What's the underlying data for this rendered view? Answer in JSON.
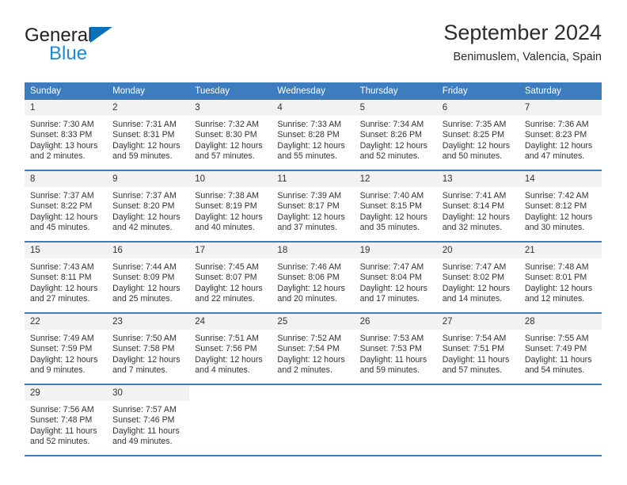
{
  "brand": {
    "name_line1": "General",
    "name_line2": "Blue",
    "flag_icon": "triangle-flag-icon",
    "color_dark": "#231f20",
    "color_blue": "#1a8bd6"
  },
  "header": {
    "title": "September 2024",
    "location": "Benimuslem, Valencia, Spain"
  },
  "theme": {
    "header_blue": "#3d7cbf",
    "daynum_background": "#f2f2f2",
    "text": "#333333"
  },
  "weekdays": [
    "Sunday",
    "Monday",
    "Tuesday",
    "Wednesday",
    "Thursday",
    "Friday",
    "Saturday"
  ],
  "labels": {
    "sunrise_prefix": "Sunrise:",
    "sunset_prefix": "Sunset:",
    "daylight_prefix": "Daylight:"
  },
  "weeks": [
    [
      {
        "day": "1",
        "sunrise": "Sunrise: 7:30 AM",
        "sunset": "Sunset: 8:33 PM",
        "daylight": "Daylight: 13 hours and 2 minutes."
      },
      {
        "day": "2",
        "sunrise": "Sunrise: 7:31 AM",
        "sunset": "Sunset: 8:31 PM",
        "daylight": "Daylight: 12 hours and 59 minutes."
      },
      {
        "day": "3",
        "sunrise": "Sunrise: 7:32 AM",
        "sunset": "Sunset: 8:30 PM",
        "daylight": "Daylight: 12 hours and 57 minutes."
      },
      {
        "day": "4",
        "sunrise": "Sunrise: 7:33 AM",
        "sunset": "Sunset: 8:28 PM",
        "daylight": "Daylight: 12 hours and 55 minutes."
      },
      {
        "day": "5",
        "sunrise": "Sunrise: 7:34 AM",
        "sunset": "Sunset: 8:26 PM",
        "daylight": "Daylight: 12 hours and 52 minutes."
      },
      {
        "day": "6",
        "sunrise": "Sunrise: 7:35 AM",
        "sunset": "Sunset: 8:25 PM",
        "daylight": "Daylight: 12 hours and 50 minutes."
      },
      {
        "day": "7",
        "sunrise": "Sunrise: 7:36 AM",
        "sunset": "Sunset: 8:23 PM",
        "daylight": "Daylight: 12 hours and 47 minutes."
      }
    ],
    [
      {
        "day": "8",
        "sunrise": "Sunrise: 7:37 AM",
        "sunset": "Sunset: 8:22 PM",
        "daylight": "Daylight: 12 hours and 45 minutes."
      },
      {
        "day": "9",
        "sunrise": "Sunrise: 7:37 AM",
        "sunset": "Sunset: 8:20 PM",
        "daylight": "Daylight: 12 hours and 42 minutes."
      },
      {
        "day": "10",
        "sunrise": "Sunrise: 7:38 AM",
        "sunset": "Sunset: 8:19 PM",
        "daylight": "Daylight: 12 hours and 40 minutes."
      },
      {
        "day": "11",
        "sunrise": "Sunrise: 7:39 AM",
        "sunset": "Sunset: 8:17 PM",
        "daylight": "Daylight: 12 hours and 37 minutes."
      },
      {
        "day": "12",
        "sunrise": "Sunrise: 7:40 AM",
        "sunset": "Sunset: 8:15 PM",
        "daylight": "Daylight: 12 hours and 35 minutes."
      },
      {
        "day": "13",
        "sunrise": "Sunrise: 7:41 AM",
        "sunset": "Sunset: 8:14 PM",
        "daylight": "Daylight: 12 hours and 32 minutes."
      },
      {
        "day": "14",
        "sunrise": "Sunrise: 7:42 AM",
        "sunset": "Sunset: 8:12 PM",
        "daylight": "Daylight: 12 hours and 30 minutes."
      }
    ],
    [
      {
        "day": "15",
        "sunrise": "Sunrise: 7:43 AM",
        "sunset": "Sunset: 8:11 PM",
        "daylight": "Daylight: 12 hours and 27 minutes."
      },
      {
        "day": "16",
        "sunrise": "Sunrise: 7:44 AM",
        "sunset": "Sunset: 8:09 PM",
        "daylight": "Daylight: 12 hours and 25 minutes."
      },
      {
        "day": "17",
        "sunrise": "Sunrise: 7:45 AM",
        "sunset": "Sunset: 8:07 PM",
        "daylight": "Daylight: 12 hours and 22 minutes."
      },
      {
        "day": "18",
        "sunrise": "Sunrise: 7:46 AM",
        "sunset": "Sunset: 8:06 PM",
        "daylight": "Daylight: 12 hours and 20 minutes."
      },
      {
        "day": "19",
        "sunrise": "Sunrise: 7:47 AM",
        "sunset": "Sunset: 8:04 PM",
        "daylight": "Daylight: 12 hours and 17 minutes."
      },
      {
        "day": "20",
        "sunrise": "Sunrise: 7:47 AM",
        "sunset": "Sunset: 8:02 PM",
        "daylight": "Daylight: 12 hours and 14 minutes."
      },
      {
        "day": "21",
        "sunrise": "Sunrise: 7:48 AM",
        "sunset": "Sunset: 8:01 PM",
        "daylight": "Daylight: 12 hours and 12 minutes."
      }
    ],
    [
      {
        "day": "22",
        "sunrise": "Sunrise: 7:49 AM",
        "sunset": "Sunset: 7:59 PM",
        "daylight": "Daylight: 12 hours and 9 minutes."
      },
      {
        "day": "23",
        "sunrise": "Sunrise: 7:50 AM",
        "sunset": "Sunset: 7:58 PM",
        "daylight": "Daylight: 12 hours and 7 minutes."
      },
      {
        "day": "24",
        "sunrise": "Sunrise: 7:51 AM",
        "sunset": "Sunset: 7:56 PM",
        "daylight": "Daylight: 12 hours and 4 minutes."
      },
      {
        "day": "25",
        "sunrise": "Sunrise: 7:52 AM",
        "sunset": "Sunset: 7:54 PM",
        "daylight": "Daylight: 12 hours and 2 minutes."
      },
      {
        "day": "26",
        "sunrise": "Sunrise: 7:53 AM",
        "sunset": "Sunset: 7:53 PM",
        "daylight": "Daylight: 11 hours and 59 minutes."
      },
      {
        "day": "27",
        "sunrise": "Sunrise: 7:54 AM",
        "sunset": "Sunset: 7:51 PM",
        "daylight": "Daylight: 11 hours and 57 minutes."
      },
      {
        "day": "28",
        "sunrise": "Sunrise: 7:55 AM",
        "sunset": "Sunset: 7:49 PM",
        "daylight": "Daylight: 11 hours and 54 minutes."
      }
    ],
    [
      {
        "day": "29",
        "sunrise": "Sunrise: 7:56 AM",
        "sunset": "Sunset: 7:48 PM",
        "daylight": "Daylight: 11 hours and 52 minutes."
      },
      {
        "day": "30",
        "sunrise": "Sunrise: 7:57 AM",
        "sunset": "Sunset: 7:46 PM",
        "daylight": "Daylight: 11 hours and 49 minutes."
      },
      {
        "day": "",
        "sunrise": "",
        "sunset": "",
        "daylight": ""
      },
      {
        "day": "",
        "sunrise": "",
        "sunset": "",
        "daylight": ""
      },
      {
        "day": "",
        "sunrise": "",
        "sunset": "",
        "daylight": ""
      },
      {
        "day": "",
        "sunrise": "",
        "sunset": "",
        "daylight": ""
      },
      {
        "day": "",
        "sunrise": "",
        "sunset": "",
        "daylight": ""
      }
    ]
  ]
}
